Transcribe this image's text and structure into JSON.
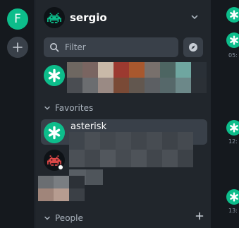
{
  "spaces": {
    "home_initial": "F"
  },
  "header": {
    "user_name": "sergio"
  },
  "filter": {
    "placeholder": "Filter"
  },
  "sections": {
    "favorites_label": "Favorites",
    "people_label": "People"
  },
  "favorites": [
    {
      "name": "asterisk"
    }
  ],
  "timeline": {
    "times": [
      "05:",
      "12:",
      "13:"
    ]
  },
  "colors": {
    "accent": "#0dbd8b",
    "panel": "#21262c",
    "rail": "#15191e",
    "selected_row": "#394049",
    "invader": "#0dbd8b",
    "invader_dm": "#e04848"
  },
  "icons": {
    "add": "plus-icon",
    "chevron": "chevron-down-icon",
    "search": "search-icon",
    "explore": "compass-icon",
    "room_avatar": "asterisk-icon",
    "user_avatar": "space-invader-icon"
  }
}
